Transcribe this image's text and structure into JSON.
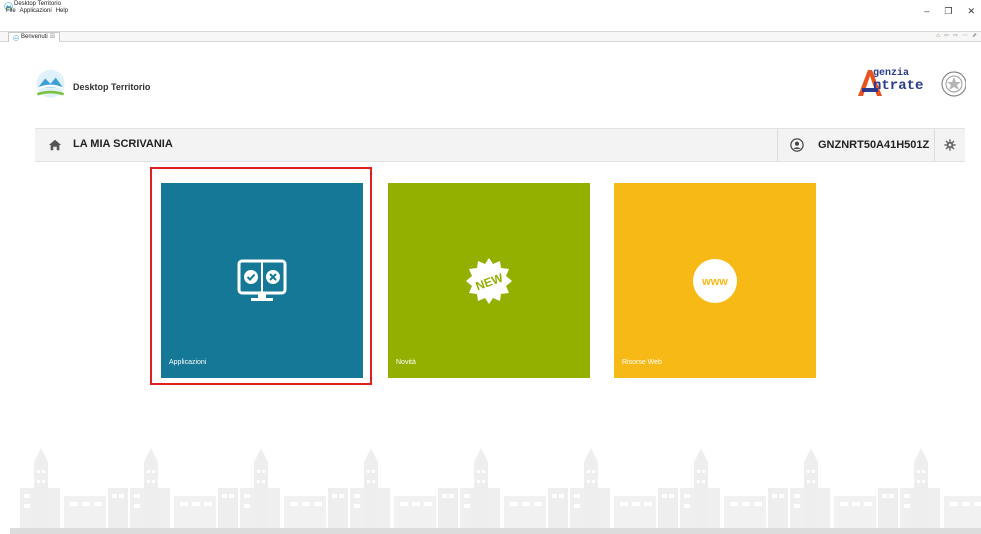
{
  "window": {
    "title": "Desktop Territorio",
    "menu": [
      "File",
      "Applicazioni",
      "Help"
    ],
    "controls": {
      "minimize": "–",
      "restore": "❐",
      "close": "✕"
    }
  },
  "editor_tab": {
    "label": "Benvenuti",
    "close": "☒"
  },
  "nav_tools": [
    "⌂",
    "⇦",
    "⇨",
    "⋯",
    "⬈"
  ],
  "header": {
    "brand_name": "Desktop Territorio",
    "agency_top": "genzia",
    "agency_bottom": "ntrate"
  },
  "breadcrumb": {
    "title": "LA MIA SCRIVANIA",
    "user_code": "GNZNRT50A41H501Z"
  },
  "tiles": [
    {
      "label": "Applicazioni",
      "color": "#147896",
      "icon": "monitor-check-icon"
    },
    {
      "label": "Novità",
      "color": "#93b000",
      "icon": "new-badge-icon",
      "badge_text": "NEW"
    },
    {
      "label": "Risorse Web",
      "color": "#f7b915",
      "icon": "www-icon",
      "badge_text": "www"
    }
  ],
  "selection_color": "#e02020"
}
